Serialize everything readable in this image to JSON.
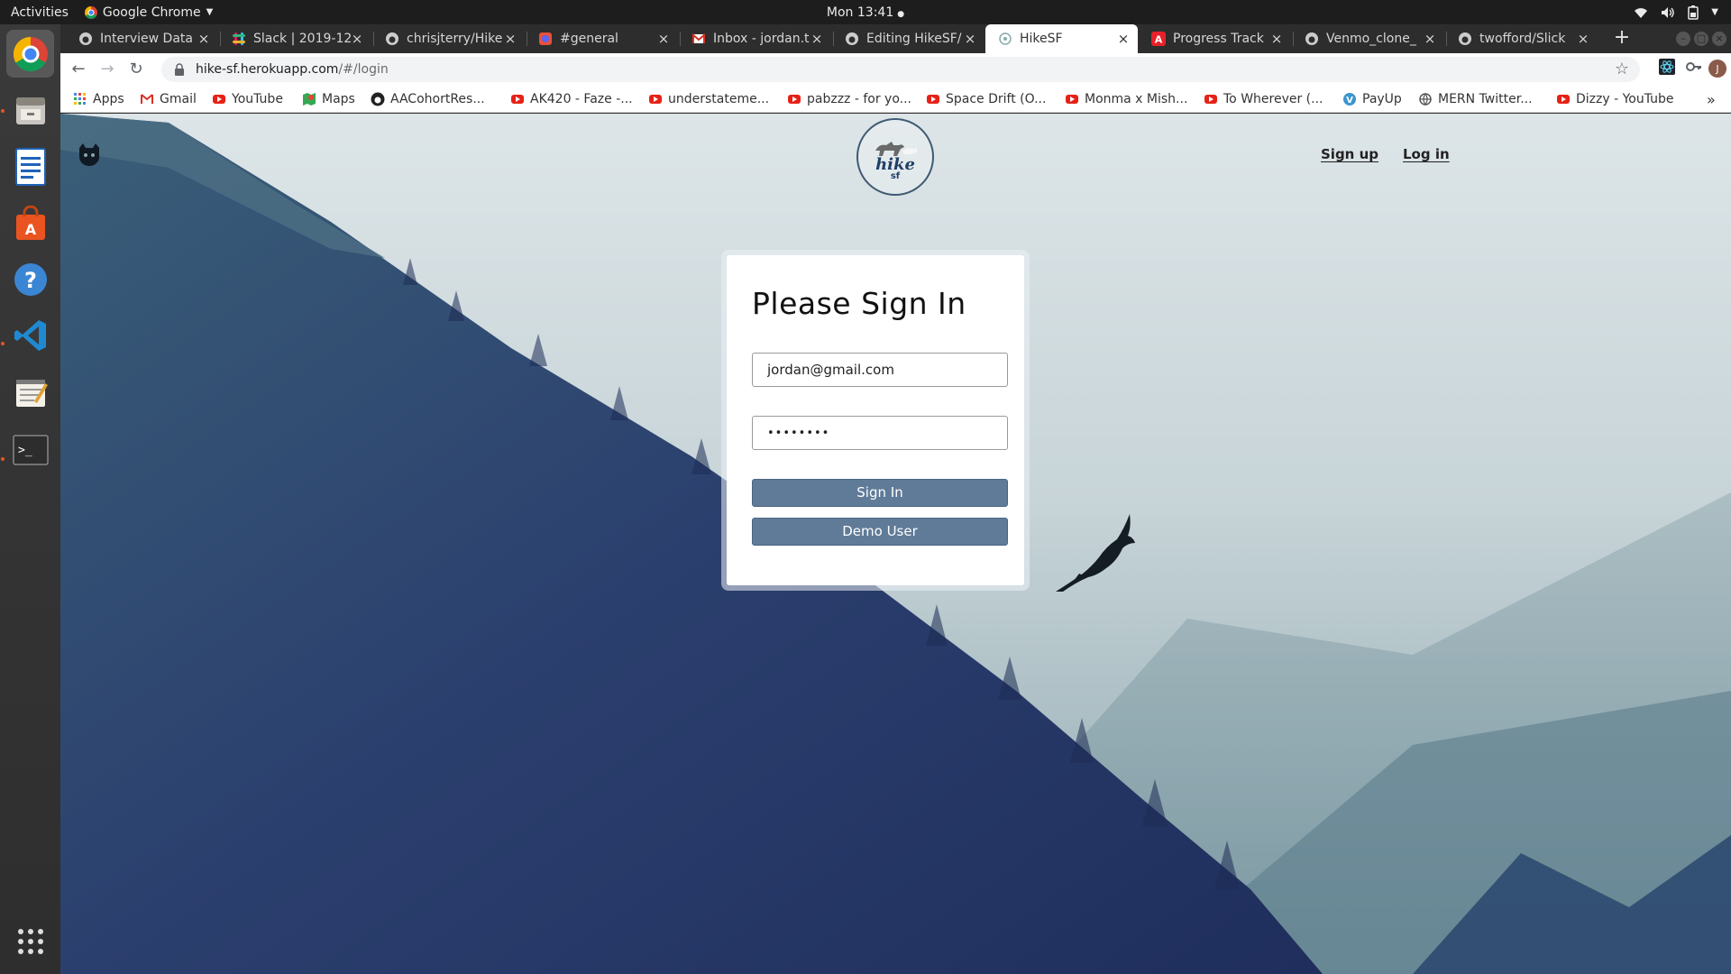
{
  "system": {
    "activities": "Activities",
    "app_name": "Google Chrome",
    "clock": "Mon 13:41"
  },
  "tabs": [
    {
      "title": "Interview Data",
      "icon": "github-icon"
    },
    {
      "title": "Slack | 2019-12-",
      "icon": "slack-icon"
    },
    {
      "title": "chrisjterry/Hike",
      "icon": "github-icon"
    },
    {
      "title": "#general",
      "icon": "discord-icon"
    },
    {
      "title": "Inbox - jordan.t",
      "icon": "gmail-icon"
    },
    {
      "title": "Editing HikeSF/",
      "icon": "github-icon"
    },
    {
      "title": "HikeSF",
      "icon": "hikesf-icon",
      "active": true
    },
    {
      "title": "Progress Track",
      "icon": "app-academy-icon"
    },
    {
      "title": "Venmo_clone_",
      "icon": "github-icon"
    },
    {
      "title": "twofford/Slick",
      "icon": "github-icon"
    }
  ],
  "address_bar": {
    "host": "hike-sf.herokuapp.com",
    "path": "/#/login"
  },
  "bookmarks": [
    {
      "label": "Apps",
      "icon": "apps-grid-icon"
    },
    {
      "label": "Gmail",
      "icon": "gmail-icon"
    },
    {
      "label": "YouTube",
      "icon": "youtube-icon"
    },
    {
      "label": "Maps",
      "icon": "maps-icon"
    },
    {
      "label": "AACohortRes...",
      "icon": "github-icon"
    },
    {
      "label": "AK420 - Faze -...",
      "icon": "youtube-icon"
    },
    {
      "label": "understateme...",
      "icon": "youtube-icon"
    },
    {
      "label": "pabzzz - for yo...",
      "icon": "youtube-icon"
    },
    {
      "label": "Space Drift (O...",
      "icon": "youtube-icon"
    },
    {
      "label": "Monma x Mish...",
      "icon": "youtube-icon"
    },
    {
      "label": "To Wherever (...",
      "icon": "youtube-icon"
    },
    {
      "label": "PayUp",
      "icon": "venmo-icon"
    },
    {
      "label": "MERN Twitter...",
      "icon": "globe-icon"
    },
    {
      "label": "Dizzy - YouTube",
      "icon": "youtube-icon"
    }
  ],
  "bookmarks_overflow": "»",
  "site": {
    "logo_word": "hike",
    "logo_sub": "sf",
    "nav": {
      "signup": "Sign up",
      "login": "Log in"
    }
  },
  "login": {
    "heading": "Please Sign In",
    "email": "jordan@gmail.com",
    "password_masked": "••••••••",
    "sign_in_label": "Sign In",
    "demo_label": "Demo User"
  },
  "colors": {
    "button": "#5f7b98",
    "accent_dock": "#e95420",
    "chrome_frame": "#2d2d2d"
  }
}
